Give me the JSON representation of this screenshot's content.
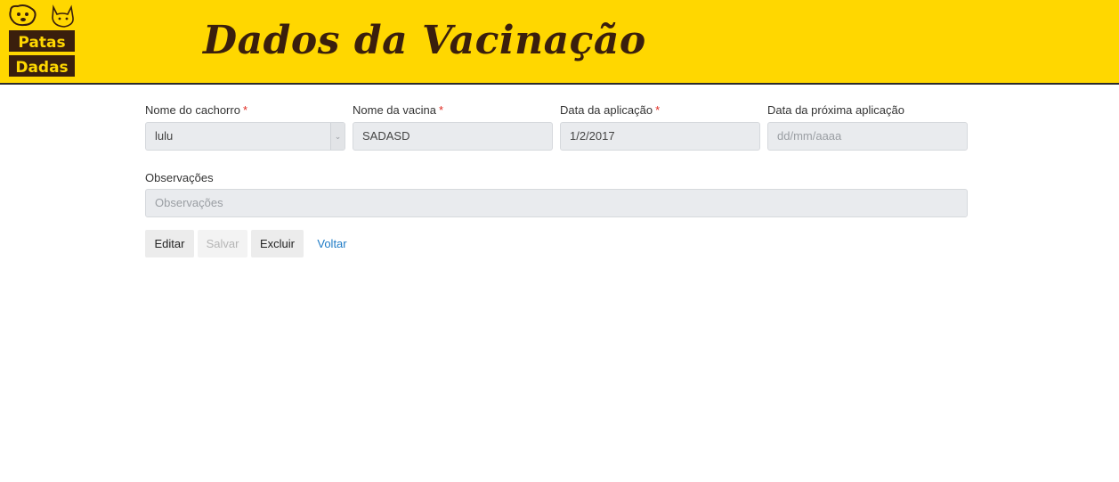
{
  "header": {
    "logo_text_line1": "Patas",
    "logo_text_line2": "Dadas",
    "title": "Dados da Vacinação",
    "brand_color": "#ffd700"
  },
  "form": {
    "dog_name": {
      "label": "Nome do cachorro",
      "required_mark": "*",
      "value": "lulu"
    },
    "vaccine_name": {
      "label": "Nome da vacina",
      "required_mark": "*",
      "value": "SADASD"
    },
    "application_date": {
      "label": "Data da aplicação",
      "required_mark": "*",
      "value": "1/2/2017"
    },
    "next_application_date": {
      "label": "Data da próxima aplicação",
      "value": "",
      "placeholder": "dd/mm/aaaa"
    },
    "notes": {
      "label": "Observações",
      "value": "",
      "placeholder": "Observações"
    }
  },
  "actions": {
    "edit": "Editar",
    "save": "Salvar",
    "delete": "Excluir",
    "back": "Voltar"
  }
}
